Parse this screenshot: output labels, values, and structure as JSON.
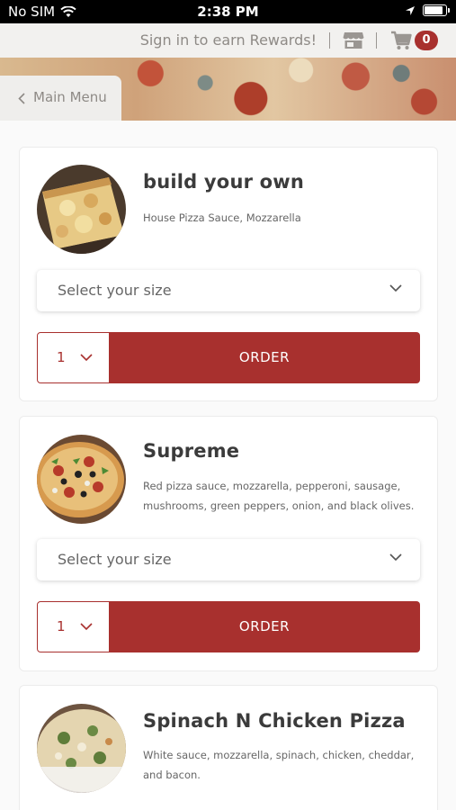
{
  "status_bar": {
    "carrier": "No SIM",
    "time": "2:38 PM",
    "battery_level": 0.9
  },
  "top_bar": {
    "rewards_text": "Sign in to earn Rewards!",
    "cart_count": "0",
    "store_icon": "storefront-icon",
    "cart_icon": "cart-icon"
  },
  "nav": {
    "back_label": "Main Menu"
  },
  "colors": {
    "accent": "#a8302e",
    "text": "#3b3b3b",
    "muted": "#8e8a86"
  },
  "items": [
    {
      "title": "build your own",
      "description": "House Pizza Sauce, Mozzarella",
      "size_placeholder": "Select your size",
      "quantity": "1",
      "order_label": "ORDER"
    },
    {
      "title": "Supreme",
      "description": "Red pizza sauce, mozzarella, pepperoni, sausage, mushrooms, green peppers, onion, and black olives.",
      "size_placeholder": "Select your size",
      "quantity": "1",
      "order_label": "ORDER"
    },
    {
      "title": "Spinach N Chicken Pizza",
      "description": "White sauce, mozzarella, spinach, chicken, cheddar, and bacon."
    }
  ]
}
